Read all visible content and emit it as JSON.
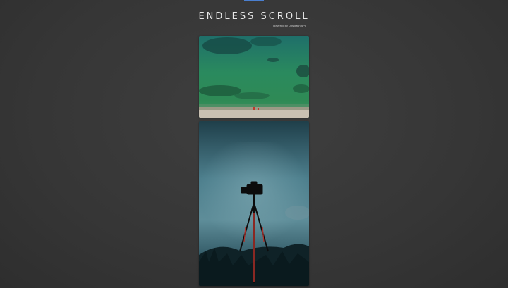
{
  "header": {
    "title": "ENDLESS SCROLL",
    "subtitle": "powered by Unsplash API"
  },
  "feed": {
    "photos": [
      {
        "subject": "aerial-coastline"
      },
      {
        "subject": "camera-on-tripod-fog"
      }
    ]
  },
  "colors": {
    "background": "#3a3a3a",
    "title": "#e8e8e8",
    "accent": "#4a7fd0"
  }
}
